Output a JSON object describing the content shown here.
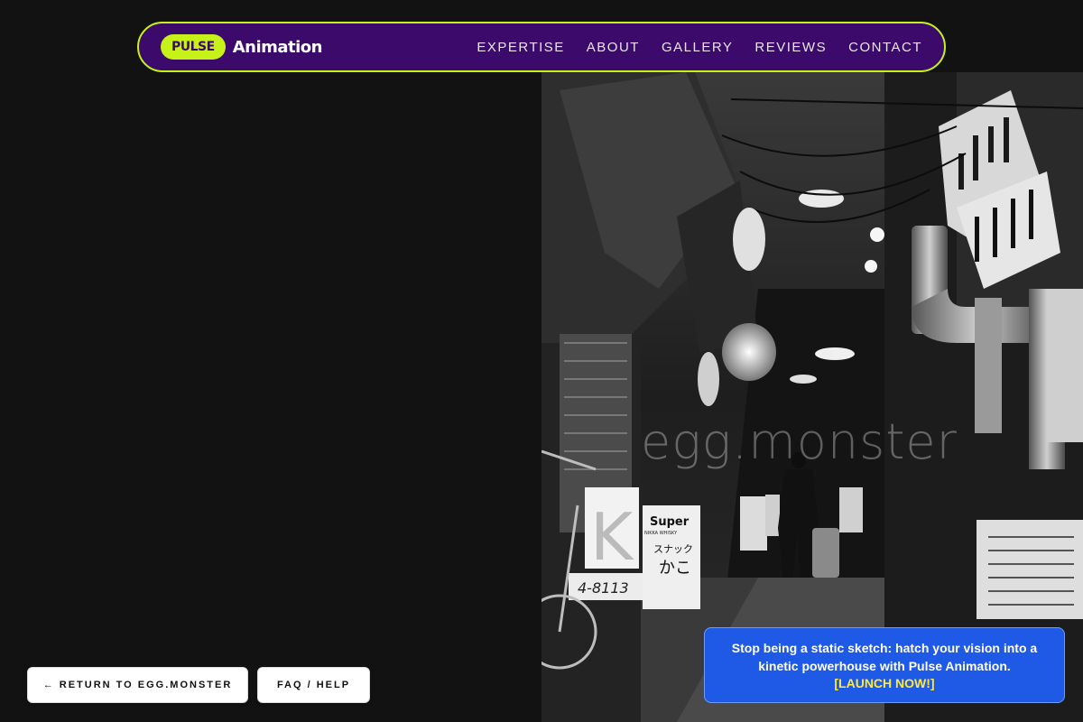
{
  "nav": {
    "badge": "PULSE",
    "brand_name": "Animation",
    "links": [
      "EXPERTISE",
      "ABOUT",
      "GALLERY",
      "REVIEWS",
      "CONTACT"
    ]
  },
  "hero": {
    "watermark": "egg.monster",
    "signs": {
      "k_sign": "K",
      "phone": "4-8113",
      "super_sign": "Super",
      "nikka": "NIKKA WHISKY",
      "snack_1": "スナック",
      "snack_2": "かこ"
    }
  },
  "footer_buttons": {
    "return_label": "← RETURN TO EGG.MONSTER",
    "faq_label": "FAQ / HELP"
  },
  "promo": {
    "text": "Stop being a static sketch: hatch your vision into a kinetic powerhouse with Pulse Animation.",
    "cta": "[LAUNCH NOW!]"
  },
  "colors": {
    "background": "#121212",
    "nav_bg": "#3c0a6b",
    "accent": "#c6f21a",
    "promo_bg": "#1f5ae6",
    "cta": "#ffe93a"
  }
}
